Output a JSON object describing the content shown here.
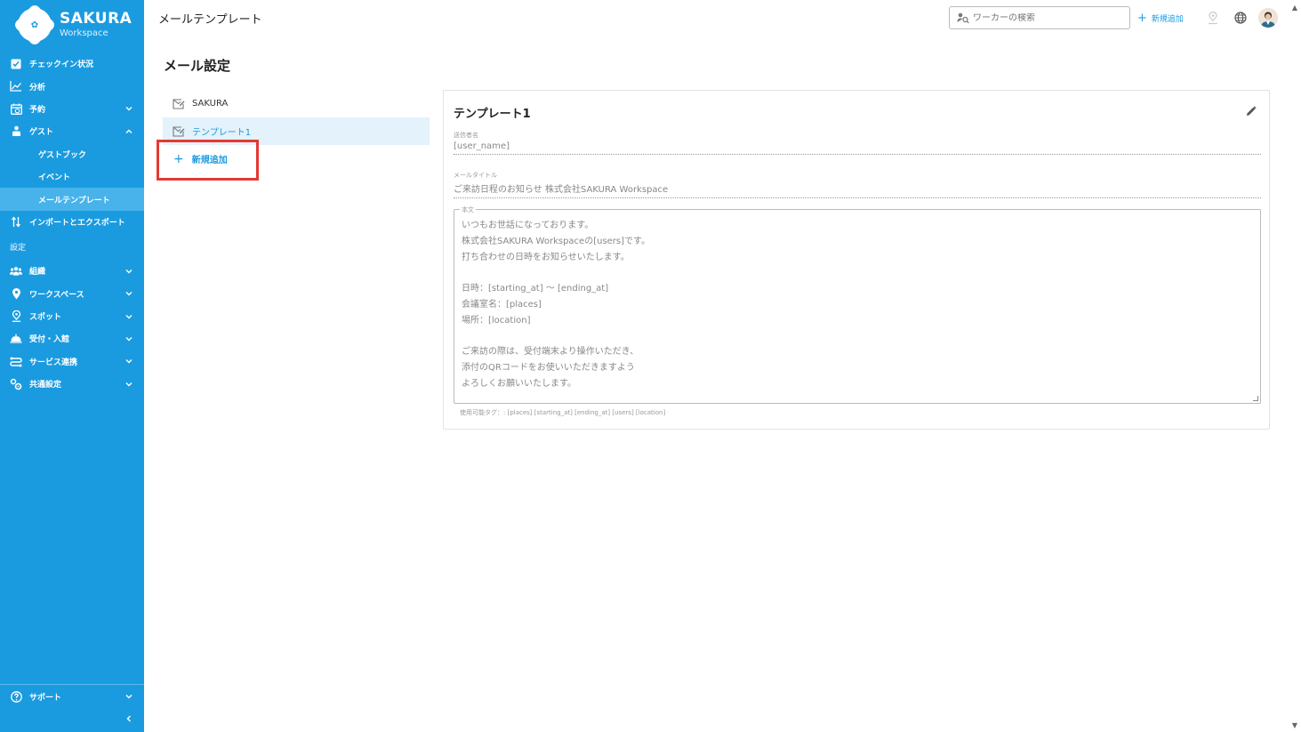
{
  "brand": {
    "title": "SAKURA",
    "subtitle": "Workspace"
  },
  "colors": {
    "primary": "#1a9be0",
    "highlight_box": "#e53935",
    "active_bg": "#e3f2fb"
  },
  "sidebar": {
    "items": [
      {
        "label": "チェックイン状況",
        "icon": "checkbox-icon"
      },
      {
        "label": "分析",
        "icon": "chart-line-icon"
      },
      {
        "label": "予約",
        "icon": "calendar-icon",
        "chevron": "down"
      },
      {
        "label": "ゲスト",
        "icon": "guest-icon",
        "chevron": "up"
      }
    ],
    "guest_sub": [
      {
        "label": "ゲストブック"
      },
      {
        "label": "イベント"
      },
      {
        "label": "メールテンプレート",
        "active": true
      }
    ],
    "import_export": {
      "label": "インポートとエクスポート",
      "icon": "import-export-icon"
    },
    "settings_section": "設定",
    "settings_items": [
      {
        "label": "組織",
        "icon": "people-icon",
        "chevron": "down"
      },
      {
        "label": "ワークスペース",
        "icon": "location-pin-icon",
        "chevron": "down"
      },
      {
        "label": "スポット",
        "icon": "spot-icon",
        "chevron": "down"
      },
      {
        "label": "受付・入館",
        "icon": "reception-bell-icon",
        "chevron": "down"
      },
      {
        "label": "サービス連携",
        "icon": "integration-icon",
        "chevron": "down"
      },
      {
        "label": "共通設定",
        "icon": "gears-icon",
        "chevron": "down"
      }
    ],
    "support": {
      "label": "サポート",
      "icon": "help-circle-icon",
      "chevron": "down"
    }
  },
  "header": {
    "page_title": "メールテンプレート",
    "search_placeholder": "ワーカーの検索",
    "add_label": "新規追加"
  },
  "main": {
    "title": "メール設定",
    "templates": [
      {
        "label": "SAKURA",
        "active": false
      },
      {
        "label": "テンプレート1",
        "active": true
      }
    ],
    "add_label": "新規追加"
  },
  "card": {
    "title": "テンプレート1",
    "sender_label": "送信者名",
    "sender_value": "[user_name]",
    "subject_label": "メールタイトル",
    "subject_value": "ご来訪日程のお知らせ 株式会社SAKURA Workspace",
    "body_label": "本文",
    "body_value": "いつもお世話になっております。\n株式会社SAKURA Workspaceの[users]です。\n打ち合わせの日時をお知らせいたします。\n\n日時：[starting_at] 〜 [ending_at]\n会議室名：[places]\n場所：[location]\n\nご来訪の際は、受付端末より操作いただき、\n添付のQRコードをお使いいただきますよう\nよろしくお願いいたします。",
    "tags_text": "使用可能タグ：: [places] [starting_at] [ending_at] [users] [location]"
  }
}
